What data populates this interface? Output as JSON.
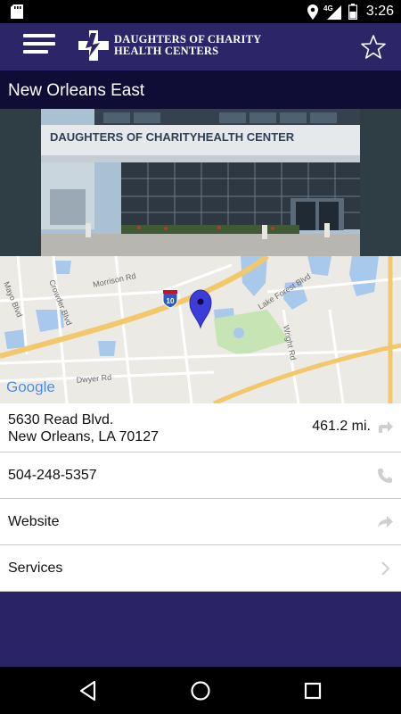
{
  "status_bar": {
    "time": "3:26",
    "network": "4G"
  },
  "app_bar": {
    "logo_line1": "DAUGHTERS OF CHARITY",
    "logo_line2": "HEALTH CENTERS"
  },
  "location": {
    "title": "New Orleans East",
    "photo_sign": "DAUGHTERS OF CHARITYHEALTH CENTER"
  },
  "map": {
    "attribution": "Google",
    "road_labels": [
      "Crowder Blvd",
      "Morrison Rd",
      "Mayo Blvd",
      "Lake Forest Blvd",
      "Wright Rd",
      "Dwyer Rd"
    ],
    "highway_shield": "10"
  },
  "details": {
    "address_line1": "5630 Read Blvd.",
    "address_line2": "New Orleans, LA 70127",
    "distance": "461.2 mi.",
    "phone": "504-248-5357",
    "website_label": "Website",
    "services_label": "Services"
  },
  "colors": {
    "brand": "#2c2668",
    "title_bar": "#0f0c36",
    "pin": "#3b3cd9"
  }
}
